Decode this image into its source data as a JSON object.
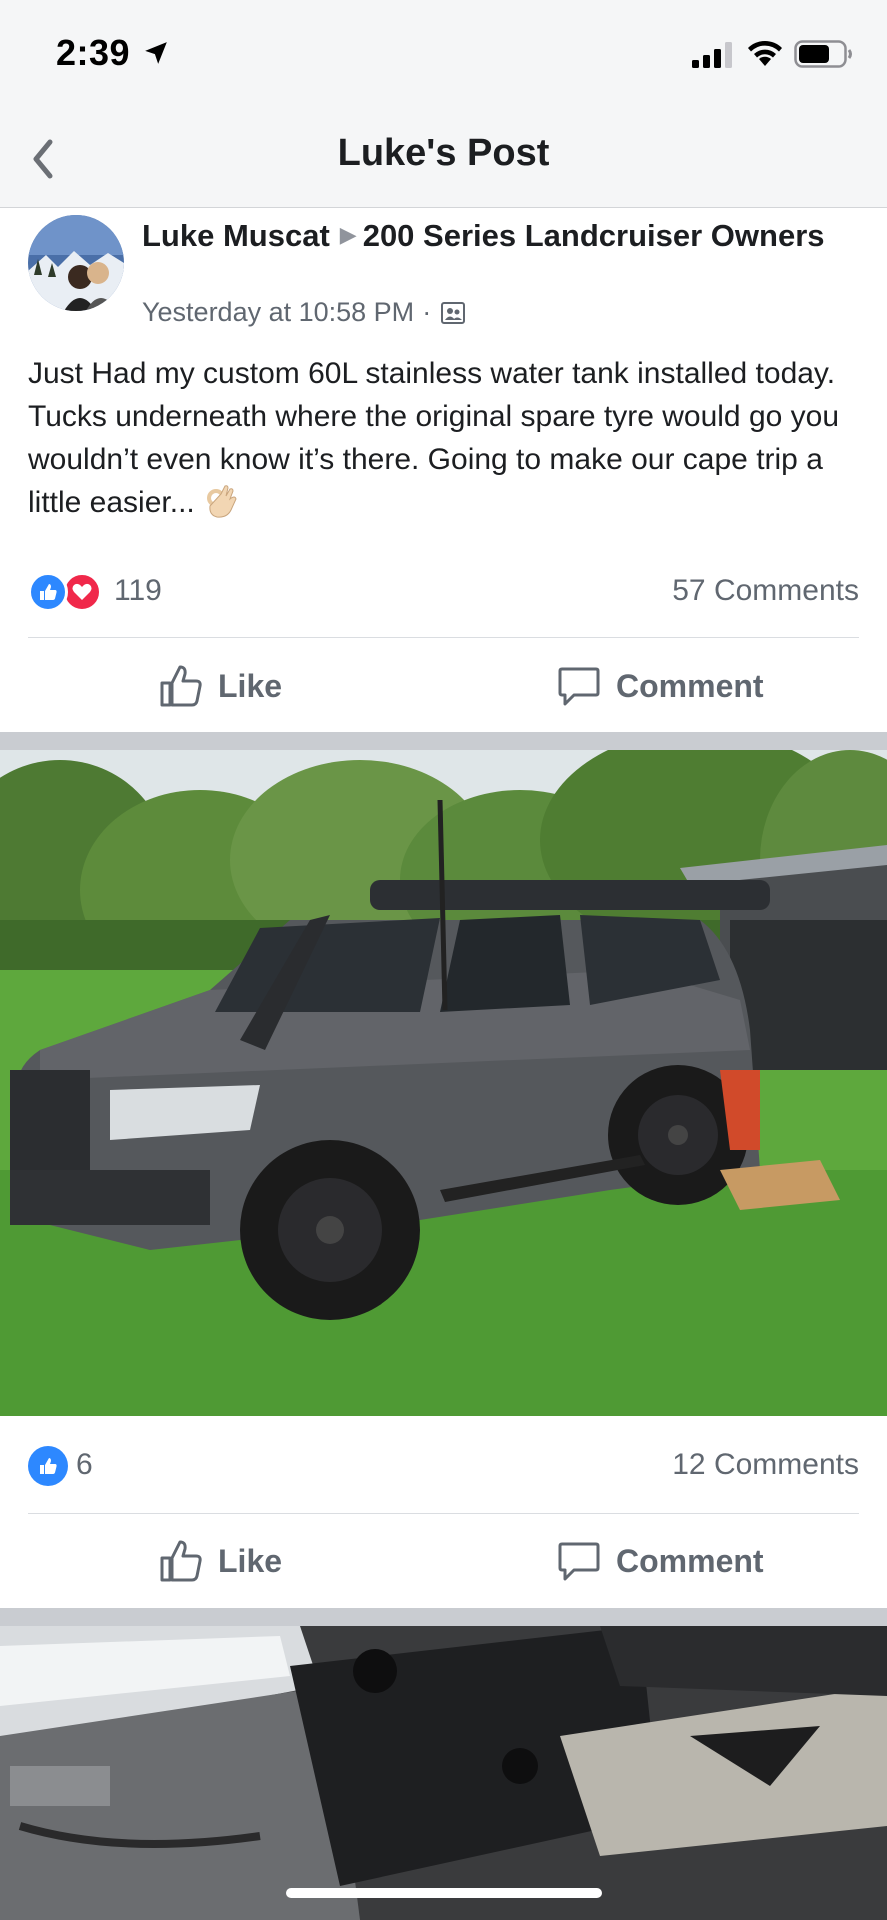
{
  "status_bar": {
    "time": "2:39",
    "icons": [
      "location-arrow-icon",
      "signal-icon",
      "wifi-icon",
      "battery-icon"
    ]
  },
  "nav": {
    "title": "Luke's Post",
    "back_icon": "chevron-left-icon"
  },
  "post": {
    "author": "Luke Muscat",
    "group": "200 Series Landcruiser Owners",
    "timestamp": "Yesterday at 10:58 PM",
    "separator": "·",
    "privacy_icon": "group-icon",
    "text": "Just Had my custom 60L stainless water tank installed today. Tucks underneath where the original spare tyre would go you wouldn’t even know it’s there. Going to make our cape trip a little easier...",
    "emoji": "ok-hand-icon",
    "reaction_count": "119",
    "comment_count": "57 Comments",
    "reactions": [
      "like",
      "love"
    ]
  },
  "actions": {
    "like_label": "Like",
    "comment_label": "Comment"
  },
  "photo1": {
    "reaction_count": "6",
    "comment_count": "12 Comments"
  },
  "colors": {
    "brand_blue": "#2d88ff",
    "love_red": "#f0284a",
    "text_secondary": "#606770",
    "separator_gray": "#c9ccd1"
  }
}
